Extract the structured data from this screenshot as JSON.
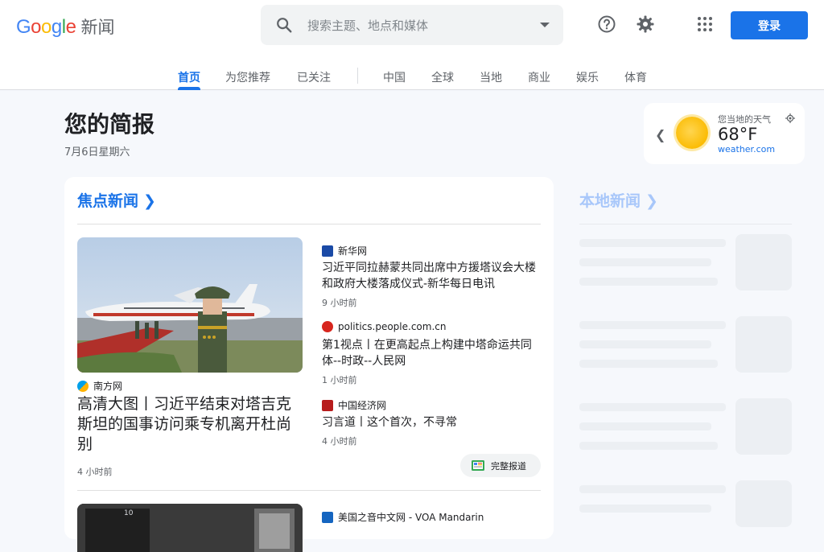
{
  "header": {
    "logo_text": "Google",
    "logo_suffix": "新闻",
    "search_placeholder": "搜索主题、地点和媒体",
    "login_label": "登录"
  },
  "tabs": [
    {
      "label": "首页",
      "active": true
    },
    {
      "label": "为您推荐"
    },
    {
      "label": "已关注"
    },
    {
      "label": "中国"
    },
    {
      "label": "全球"
    },
    {
      "label": "当地"
    },
    {
      "label": "商业"
    },
    {
      "label": "娱乐"
    },
    {
      "label": "体育"
    }
  ],
  "briefing": {
    "title": "您的简报",
    "date": "7月6日星期六"
  },
  "weather": {
    "label": "您当地的天气",
    "temperature": "68°F",
    "source": "weather.com"
  },
  "headlines": {
    "heading": "焦点新闻",
    "hero": {
      "source": "南方网",
      "title": "高清大图丨习近平结束对塔吉克斯坦的国事访问乘专机离开杜尚别",
      "time": "4 小时前"
    },
    "stories": [
      {
        "source": "新华网",
        "title": "习近平同拉赫蒙共同出席中方援塔议会大楼和政府大楼落成仪式-新华每日电讯",
        "time": "9 小时前"
      },
      {
        "source": "politics.people.com.cn",
        "title": "第1视点丨在更高起点上构建中塔命运共同体--时政--人民网",
        "time": "1 小时前"
      },
      {
        "source": "中国经济网",
        "title": "习言道丨这个首次，不寻常",
        "time": "4 小时前"
      }
    ],
    "full_coverage": "完整报道",
    "next_source": "美国之音中文网 - VOA Mandarin"
  },
  "local": {
    "heading": "本地新闻"
  },
  "colors": {
    "accent": "#1a73e8",
    "background": "#f6f8fc"
  }
}
